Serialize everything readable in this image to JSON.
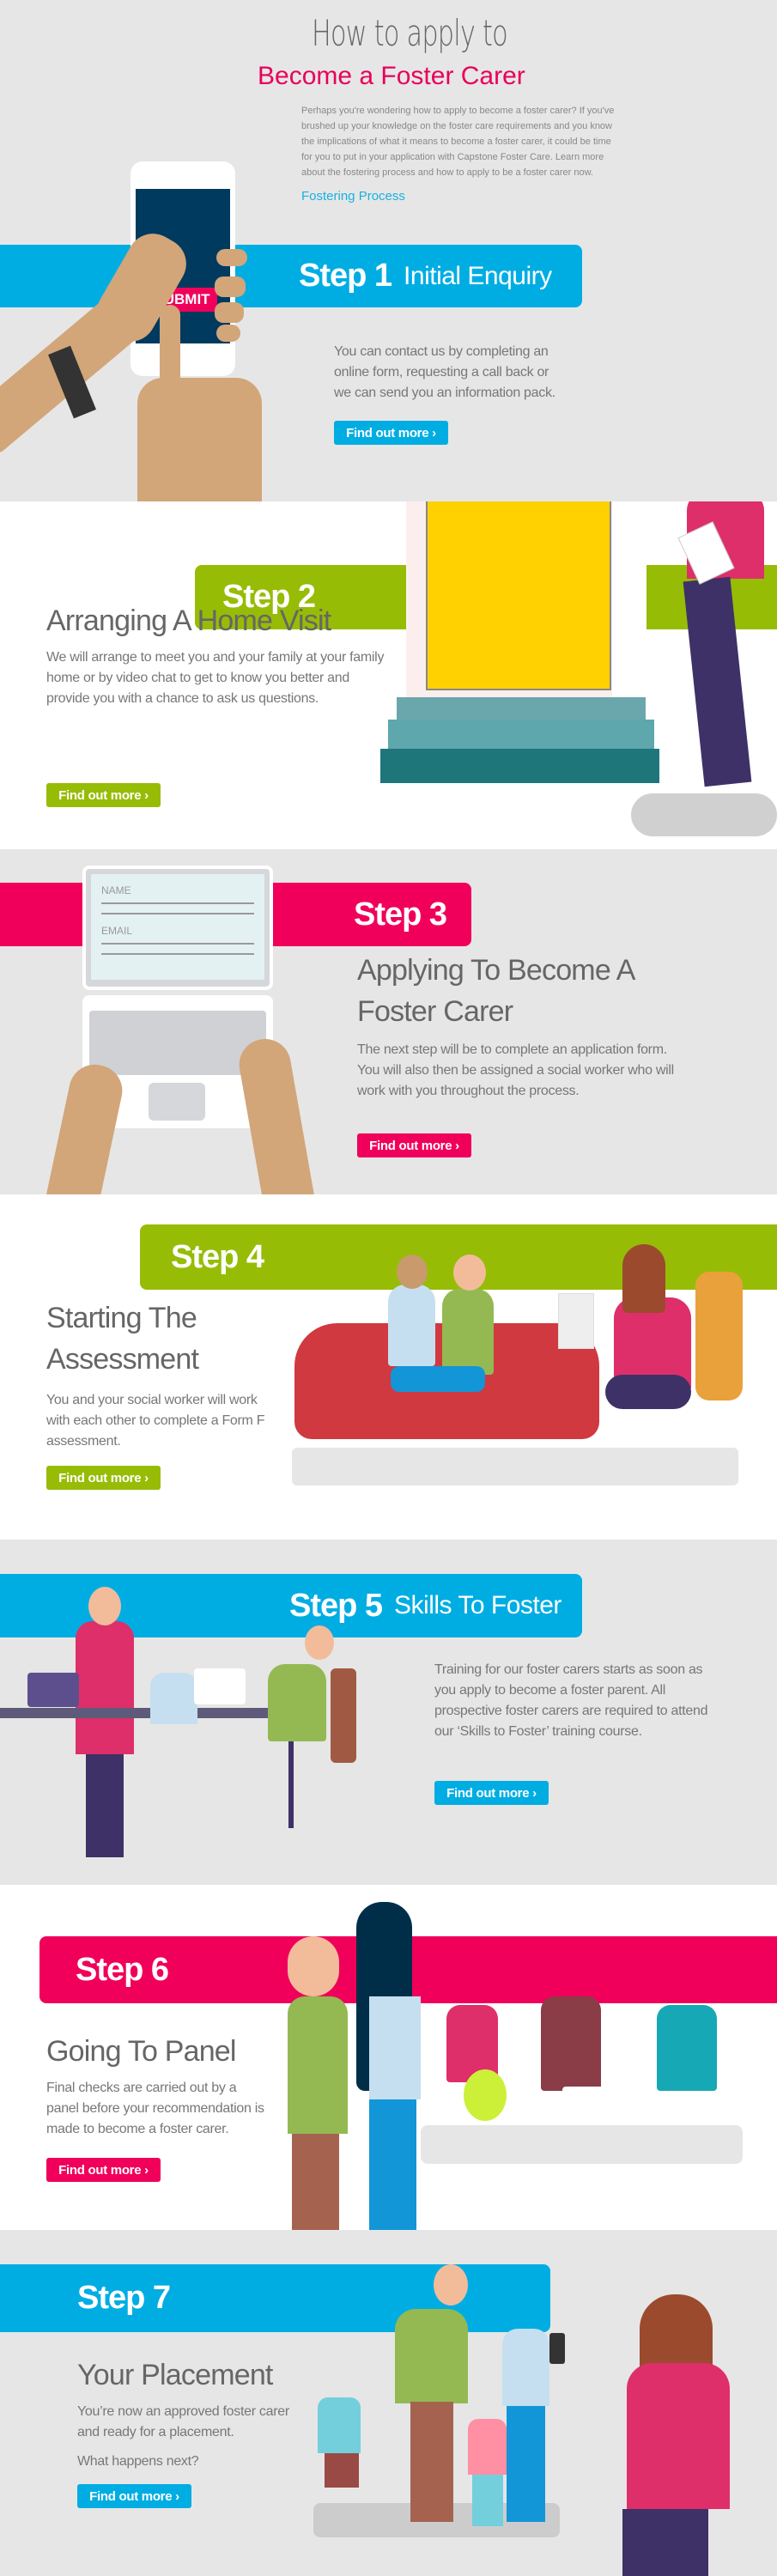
{
  "header": {
    "script_title": "How to apply to",
    "title": "Become a Foster Carer",
    "intro": "Perhaps you're wondering how to apply to become a foster carer? If you've brushed up your knowledge on the foster care requirements and you know the implications of what it means to become a foster carer, it could be time for you to put in your application with Capstone Foster Care. Learn more about the fostering process and how to apply to be a foster carer now.",
    "link": "Fostering Process"
  },
  "colors": {
    "blue": "#00ade3",
    "pink": "#f0005a",
    "green": "#97bc06",
    "background": "#e6e6e6"
  },
  "steps": [
    {
      "label": "Step 1",
      "subtitle": "Initial Enquiry",
      "body": "You can contact us by completing an online form, requesting a call back or we can send you an information pack.",
      "button": "Find out more ›",
      "illustration_text": "SUBMIT"
    },
    {
      "label": "Step 2",
      "title": "Arranging A Home Visit",
      "body": "We will arrange to meet you and your family at your family home or by video chat to get to know you better and provide you with a chance to ask us questions.",
      "button": "Find out more ›"
    },
    {
      "label": "Step 3",
      "title": "Applying To Become A Foster Carer",
      "body": "The next step will be to complete an application form. You will also then be assigned a social worker who will work with you throughout the process.",
      "button": "Find out more ›",
      "form_labels": [
        "NAME",
        "EMAIL"
      ]
    },
    {
      "label": "Step 4",
      "title": "Starting The Assessment",
      "body": "You and your social worker will work with each other to complete a Form F assessment.",
      "button": "Find out more ›"
    },
    {
      "label": "Step 5",
      "subtitle": "Skills To Foster",
      "body": "Training for our foster carers starts as soon as you apply to become a foster parent. All prospective foster carers are required to attend our ‘Skills to Foster’ training course.",
      "button": "Find out more ›"
    },
    {
      "label": "Step 6",
      "title": "Going To Panel",
      "body": "Final checks are carried out by a panel before your recommendation is made to become a foster carer.",
      "button": "Find out more ›"
    },
    {
      "label": "Step 7",
      "title": "Your Placement",
      "body": "You’re now an approved foster carer and ready for a placement.",
      "body2": "What happens next?",
      "button": "Find out more ›"
    }
  ]
}
